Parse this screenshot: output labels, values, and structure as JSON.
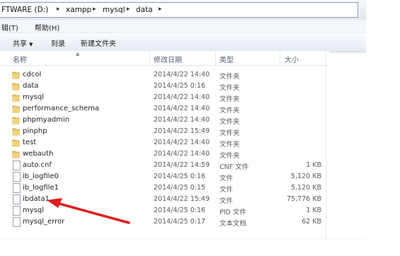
{
  "address": {
    "crumbs": [
      "FTWARE (D:)",
      "xampp",
      "mysql",
      "data"
    ]
  },
  "menubar": {
    "edit": "辑(T)",
    "help": "帮助(H)"
  },
  "toolbar": {
    "share": "共享",
    "burn": "刻录",
    "new_folder": "新建文件夹"
  },
  "columns": {
    "name": "名称",
    "date": "修改日期",
    "type": "类型",
    "size": "大小"
  },
  "files": [
    {
      "name": "cdcol",
      "date": "2014/4/22 14:40",
      "type": "文件夹",
      "size": "",
      "icon": "folder-icon"
    },
    {
      "name": "data",
      "date": "2014/4/25 0:16",
      "type": "文件夹",
      "size": "",
      "icon": "folder-icon"
    },
    {
      "name": "mysql",
      "date": "2014/4/22 14:40",
      "type": "文件夹",
      "size": "",
      "icon": "folder-icon"
    },
    {
      "name": "performance_schema",
      "date": "2014/4/22 14:40",
      "type": "文件夹",
      "size": "",
      "icon": "folder-icon"
    },
    {
      "name": "phpmyadmin",
      "date": "2014/4/22 14:40",
      "type": "文件夹",
      "size": "",
      "icon": "folder-icon"
    },
    {
      "name": "pinphp",
      "date": "2014/4/22 15:49",
      "type": "文件夹",
      "size": "",
      "icon": "folder-icon"
    },
    {
      "name": "test",
      "date": "2014/4/22 14:40",
      "type": "文件夹",
      "size": "",
      "icon": "folder-icon"
    },
    {
      "name": "webauth",
      "date": "2014/4/22 14:40",
      "type": "文件夹",
      "size": "",
      "icon": "folder-icon"
    },
    {
      "name": "auto.cnf",
      "date": "2014/4/22 14:59",
      "type": "CNF 文件",
      "size": "1 KB",
      "icon": "file-icon"
    },
    {
      "name": "ib_logfile0",
      "date": "2014/4/25 0:16",
      "type": "文件",
      "size": "5,120 KB",
      "icon": "file-icon"
    },
    {
      "name": "ib_logfile1",
      "date": "2014/4/25 0:15",
      "type": "文件",
      "size": "5,120 KB",
      "icon": "file-icon"
    },
    {
      "name": "ibdata1",
      "date": "2014/4/22 15:49",
      "type": "文件",
      "size": "75,776 KB",
      "icon": "file-icon"
    },
    {
      "name": "mysql",
      "date": "2014/4/25 0:16",
      "type": "PID 文件",
      "size": "1 KB",
      "icon": "file-icon"
    },
    {
      "name": "mysql_error",
      "date": "2014/4/25 0:17",
      "type": "文本文档",
      "size": "62 KB",
      "icon": "file-icon"
    }
  ],
  "colors": {
    "folder": "#e8c15a",
    "arrow": "#e11d1d",
    "header_text": "#4c5f7a"
  }
}
